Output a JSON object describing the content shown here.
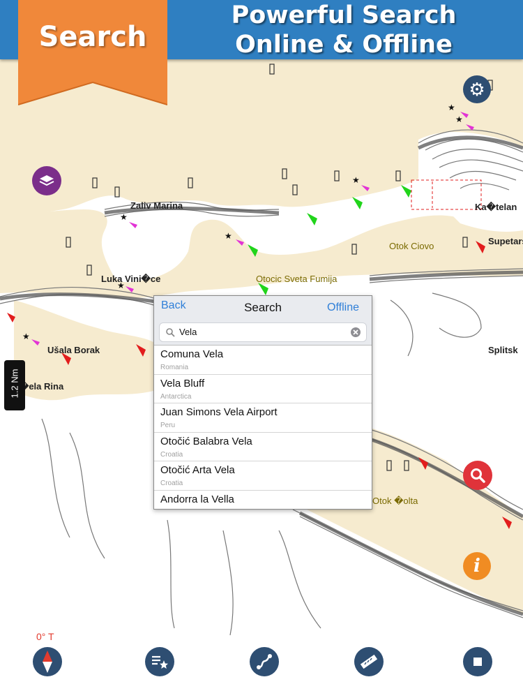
{
  "banner": {
    "tag_label": "Search",
    "title_line1": "Powerful Search",
    "title_line2": "Online & Offline"
  },
  "map": {
    "place_labels": [
      "Zaliv Marina",
      "Luka Vini�ce",
      "Ušala Borak",
      "�ela Rina",
      "Otok Ciovo",
      "Otocic Sveta Fumija",
      "Ka�telan",
      "Supetars",
      "Splitsk",
      "Otok �olta"
    ],
    "scale_label": "1.2 Nm",
    "heading_label": "0° T"
  },
  "search_panel": {
    "back_label": "Back",
    "title": "Search",
    "offline_label": "Offline",
    "query": "Vela",
    "results": [
      {
        "name": "Comuna Vela",
        "country": "Romania"
      },
      {
        "name": "Vela Bluff",
        "country": "Antarctica"
      },
      {
        "name": "Juan Simons Vela Airport",
        "country": "Peru"
      },
      {
        "name": "Otočić Balabra Vela",
        "country": "Croatia"
      },
      {
        "name": "Otočić Arta Vela",
        "country": "Croatia"
      },
      {
        "name": "Andorra la Vella",
        "country": ""
      }
    ]
  },
  "controls": {
    "settings_icon": "gear-icon",
    "layers_icon": "layers-icon",
    "search_icon": "magnifier-icon",
    "info_icon": "info-icon",
    "info_label": "i",
    "bottom_bar": [
      "compass-icon",
      "favorites-list-icon",
      "route-icon",
      "ruler-icon",
      "record-stop-icon"
    ]
  },
  "colors": {
    "banner": "#2f7fc1",
    "tag": "#f0883a",
    "land": "#f6ebcf",
    "water": "#ffffff",
    "depth_contour": "#777777",
    "link_blue": "#2f7fd8",
    "heading_red": "#e23b2e",
    "bottom_button": "#2e4e72"
  }
}
